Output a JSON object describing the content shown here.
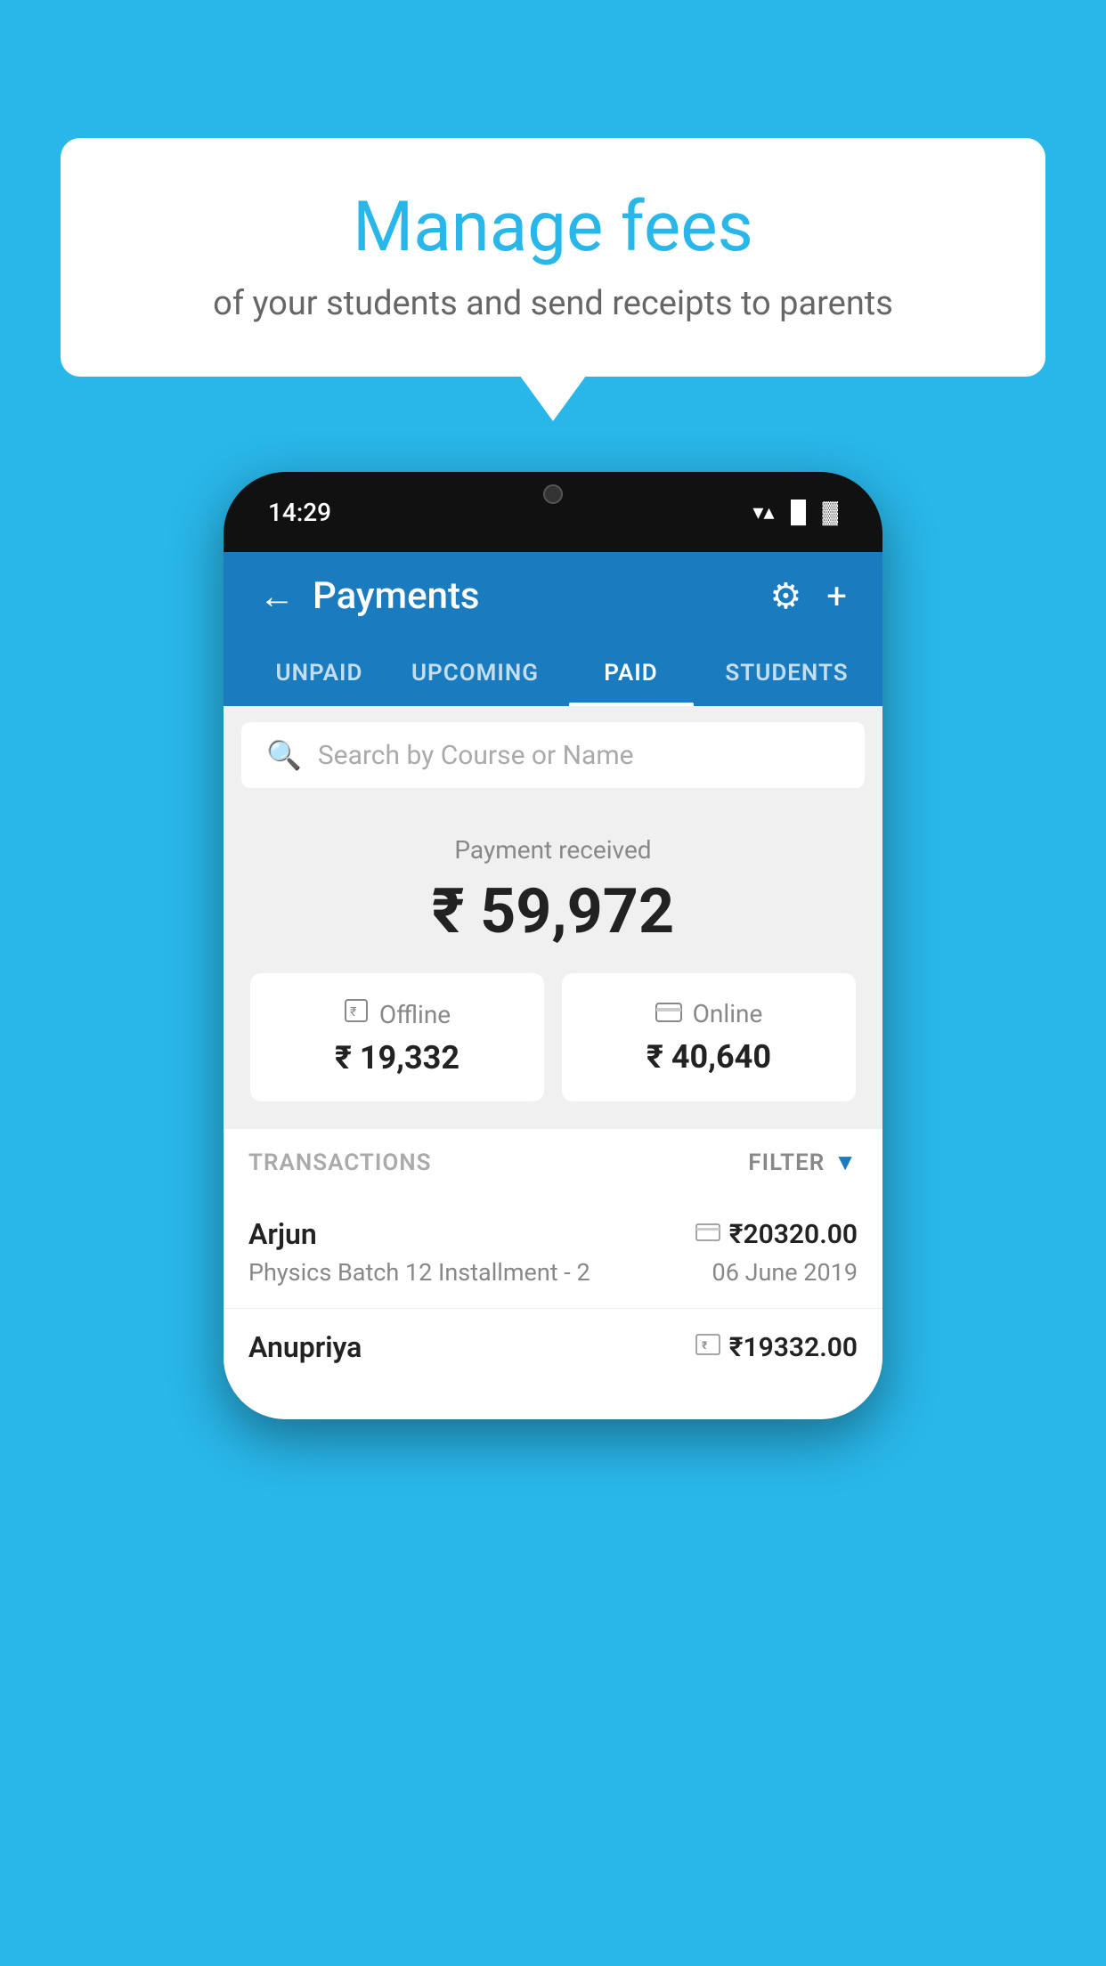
{
  "background": {
    "color": "#29b6e8"
  },
  "speech_bubble": {
    "title": "Manage fees",
    "subtitle": "of your students and send receipts to parents"
  },
  "phone": {
    "status_bar": {
      "time": "14:29"
    },
    "header": {
      "title": "Payments",
      "back_label": "←",
      "settings_label": "⚙",
      "add_label": "+"
    },
    "tabs": [
      {
        "label": "UNPAID",
        "active": false
      },
      {
        "label": "UPCOMING",
        "active": false
      },
      {
        "label": "PAID",
        "active": true
      },
      {
        "label": "STUDENTS",
        "active": false
      }
    ],
    "search": {
      "placeholder": "Search by Course or Name"
    },
    "payment_summary": {
      "label": "Payment received",
      "amount": "₹ 59,972",
      "offline": {
        "type": "Offline",
        "amount": "₹ 19,332"
      },
      "online": {
        "type": "Online",
        "amount": "₹ 40,640"
      }
    },
    "transactions": {
      "header_label": "TRANSACTIONS",
      "filter_label": "FILTER",
      "rows": [
        {
          "name": "Arjun",
          "course": "Physics Batch 12 Installment - 2",
          "amount": "₹20320.00",
          "date": "06 June 2019",
          "payment_type": "online"
        },
        {
          "name": "Anupriya",
          "amount": "₹19332.00",
          "payment_type": "offline"
        }
      ]
    }
  }
}
